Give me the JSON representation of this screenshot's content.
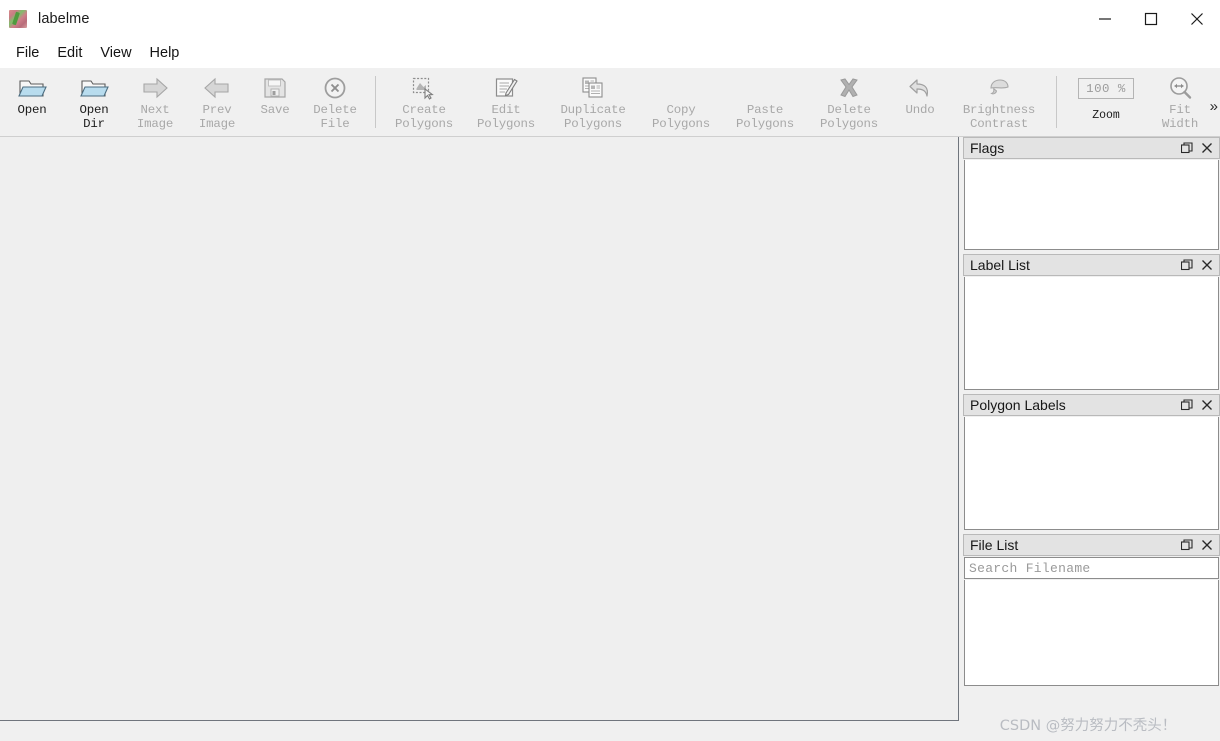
{
  "window": {
    "title": "labelme",
    "app_icon": "labelme-app-icon",
    "controls": {
      "minimize": "minimize-icon",
      "maximize": "maximize-icon",
      "close": "close-icon"
    }
  },
  "menubar": {
    "items": [
      {
        "label": "File"
      },
      {
        "label": "Edit"
      },
      {
        "label": "View"
      },
      {
        "label": "Help"
      }
    ]
  },
  "toolbar": {
    "overflow_label": "»",
    "buttons": [
      {
        "label": "Open",
        "icon": "open-folder-icon",
        "enabled": true
      },
      {
        "label": "Open\nDir",
        "icon": "open-dir-folder-icon",
        "enabled": true
      },
      {
        "label": "Next\nImage",
        "icon": "arrow-right-icon",
        "enabled": false
      },
      {
        "label": "Prev\nImage",
        "icon": "arrow-left-icon",
        "enabled": false
      },
      {
        "label": "Save",
        "icon": "floppy-disk-icon",
        "enabled": false
      },
      {
        "label": "Delete\nFile",
        "icon": "circle-x-icon",
        "enabled": false
      },
      {
        "label": "Create\nPolygons",
        "icon": "create-polygon-icon",
        "enabled": false
      },
      {
        "label": "Edit\nPolygons",
        "icon": "edit-polygon-icon",
        "enabled": false
      },
      {
        "label": "Duplicate\nPolygons",
        "icon": "duplicate-polygon-icon",
        "enabled": false
      },
      {
        "label": "Copy\nPolygons",
        "icon": "none",
        "enabled": false
      },
      {
        "label": "Paste\nPolygons",
        "icon": "none",
        "enabled": false
      },
      {
        "label": "Delete\nPolygons",
        "icon": "x-mark-icon",
        "enabled": false
      },
      {
        "label": "Undo",
        "icon": "undo-arrow-icon",
        "enabled": false
      },
      {
        "label": "Brightness\nContrast",
        "icon": "brightness-contrast-icon",
        "enabled": false
      }
    ],
    "zoom": {
      "value": "100 %",
      "caption": "Zoom"
    },
    "fit_width": {
      "label": "Fit\nWidth",
      "icon": "fit-width-magnifier-icon",
      "enabled": false
    }
  },
  "docks": [
    {
      "title": "Flags",
      "float_icon": "float-icon",
      "close_icon": "close-icon",
      "body_height": 90,
      "has_search": false
    },
    {
      "title": "Label List",
      "float_icon": "float-icon",
      "close_icon": "close-icon",
      "body_height": 113,
      "has_search": false
    },
    {
      "title": "Polygon Labels",
      "float_icon": "float-icon",
      "close_icon": "close-icon",
      "body_height": 113,
      "has_search": false
    },
    {
      "title": "File List",
      "float_icon": "float-icon",
      "close_icon": "close-icon",
      "body_height": 106,
      "has_search": true,
      "search_placeholder": "Search Filename"
    }
  ],
  "watermark": {
    "text": "CSDN @努力努力不秃头！"
  },
  "colors": {
    "toolbar_bg": "#f0f0f0",
    "canvas_bg": "#efefef",
    "dock_title_bg": "#e3e3e3",
    "disabled_text": "#a8a8a8",
    "enabled_text": "#1c1c1c"
  }
}
